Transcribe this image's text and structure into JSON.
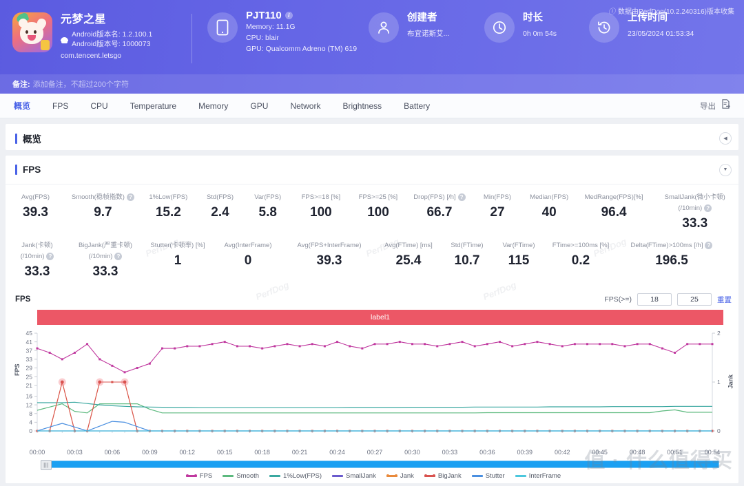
{
  "header": {
    "app": {
      "name": "元梦之星",
      "version_name": "Android版本名: 1.2.100.1",
      "version_code": "Android版本号: 1000073",
      "package": "com.tencent.letsgo"
    },
    "device": {
      "name": "PJT110",
      "memory": "Memory: 11.1G",
      "cpu": "CPU: blair",
      "gpu": "GPU: Qualcomm Adreno (TM) 619"
    },
    "creator": {
      "title": "创建者",
      "value": "布宜诺斯艾..."
    },
    "duration": {
      "title": "时长",
      "value": "0h 0m 54s"
    },
    "upload": {
      "title": "上传时间",
      "value": "23/05/2024 01:53:34"
    },
    "collect_note": "数据由PerfDog(10.2.240316)版本收集",
    "remark_label": "备注:",
    "remark_placeholder": "添加备注，不超过200个字符"
  },
  "tabs": {
    "items": [
      {
        "label": "概览",
        "active": true
      },
      {
        "label": "FPS",
        "active": false
      },
      {
        "label": "CPU",
        "active": false
      },
      {
        "label": "Temperature",
        "active": false
      },
      {
        "label": "Memory",
        "active": false
      },
      {
        "label": "GPU",
        "active": false
      },
      {
        "label": "Network",
        "active": false
      },
      {
        "label": "Brightness",
        "active": false
      },
      {
        "label": "Battery",
        "active": false
      }
    ],
    "export_label": "导出"
  },
  "overview_section": {
    "title": "概览"
  },
  "fps_section": {
    "title": "FPS",
    "metrics_row1": [
      {
        "label": "Avg(FPS)",
        "value": "39.3",
        "help": false
      },
      {
        "label": "Smooth(稳帧指数)",
        "value": "9.7",
        "help": true
      },
      {
        "label": "1%Low(FPS)",
        "value": "15.2",
        "help": false
      },
      {
        "label": "Std(FPS)",
        "value": "2.4",
        "help": false
      },
      {
        "label": "Var(FPS)",
        "value": "5.8",
        "help": false
      },
      {
        "label": "FPS>=18 [%]",
        "value": "100",
        "help": false
      },
      {
        "label": "FPS>=25 [%]",
        "value": "100",
        "help": false
      },
      {
        "label": "Drop(FPS) [/h]",
        "value": "66.7",
        "help": true
      },
      {
        "label": "Min(FPS)",
        "value": "27",
        "help": false
      },
      {
        "label": "Median(FPS)",
        "value": "40",
        "help": false
      },
      {
        "label": "MedRange(FPS)[%]",
        "value": "96.4",
        "help": false
      },
      {
        "label": "SmallJank(微小卡顿)\n(/10min)",
        "value": "33.3",
        "help": true
      }
    ],
    "metrics_row2": [
      {
        "label": "Jank(卡顿)\n(/10min)",
        "value": "33.3",
        "help": true
      },
      {
        "label": "BigJank(严重卡顿)\n(/10min)",
        "value": "33.3",
        "help": true
      },
      {
        "label": "Stutter(卡顿率) [%]",
        "value": "1",
        "help": false
      },
      {
        "label": "Avg(InterFrame)",
        "value": "0",
        "help": false
      },
      {
        "label": "Avg(FPS+InterFrame)",
        "value": "39.3",
        "help": false
      },
      {
        "label": "Avg(FTime) [ms]",
        "value": "25.4",
        "help": false
      },
      {
        "label": "Std(FTime)",
        "value": "10.7",
        "help": false
      },
      {
        "label": "Var(FTime)",
        "value": "115",
        "help": false
      },
      {
        "label": "FTime>=100ms [%]",
        "value": "0.2",
        "help": false
      },
      {
        "label": "Delta(FTime)>100ms [/h]",
        "value": "196.5",
        "help": true
      }
    ],
    "watermark": "PerfDog",
    "chart_controls": {
      "chart_name": "FPS",
      "fps_label": "FPS(>=)",
      "threshold_low": "18",
      "threshold_high": "25",
      "reset_label": "重置"
    },
    "series_label_bar": "label1"
  },
  "colors": {
    "brand": "#4a63e7",
    "header_start": "#5b5be0",
    "header_end": "#7375ea",
    "label_bar": "#ec5766",
    "scrollbar": "#1ba0f2"
  },
  "watermark_text": "值 · 什么值得买",
  "chart_data": {
    "type": "line",
    "title": "FPS",
    "xlabel": "",
    "ylabel": "FPS",
    "y2label": "Jank",
    "ylim": [
      0,
      45
    ],
    "y2lim": [
      0,
      2
    ],
    "yticks": [
      0,
      4,
      8,
      12,
      16,
      21,
      25,
      29,
      33,
      37,
      41,
      45
    ],
    "y2ticks": [
      0,
      1,
      2
    ],
    "grid": false,
    "legend_position": "bottom",
    "xticks": [
      "00:00",
      "00:03",
      "00:06",
      "00:09",
      "00:12",
      "00:15",
      "00:18",
      "00:21",
      "00:24",
      "00:27",
      "00:30",
      "00:33",
      "00:36",
      "00:39",
      "00:42",
      "00:45",
      "00:48",
      "00:51",
      "00:54"
    ],
    "x": [
      0,
      1,
      2,
      3,
      4,
      5,
      6,
      7,
      8,
      9,
      10,
      11,
      12,
      13,
      14,
      15,
      16,
      17,
      18,
      19,
      20,
      21,
      22,
      23,
      24,
      25,
      26,
      27,
      28,
      29,
      30,
      31,
      32,
      33,
      34,
      35,
      36,
      37,
      38,
      39,
      40,
      41,
      42,
      43,
      44,
      45,
      46,
      47,
      48,
      49,
      50,
      51,
      52,
      53,
      54
    ],
    "series": [
      {
        "name": "FPS",
        "color": "#c0399f",
        "axis": "left",
        "markers": true,
        "values": [
          38,
          36,
          33,
          36,
          40,
          33,
          30,
          27,
          29,
          31,
          38,
          38,
          39,
          39,
          40,
          41,
          39,
          39,
          38,
          39,
          40,
          39,
          40,
          39,
          41,
          39,
          38,
          40,
          40,
          41,
          40,
          40,
          39,
          40,
          41,
          39,
          40,
          41,
          39,
          40,
          41,
          40,
          39,
          40,
          40,
          40,
          40,
          39,
          40,
          40,
          38,
          36,
          40,
          40,
          40
        ]
      },
      {
        "name": "Smooth",
        "color": "#5cb97e",
        "axis": "left",
        "markers": false,
        "values": [
          9.5,
          11,
          12.5,
          9,
          8.3,
          12.5,
          12.5,
          12.5,
          12.5,
          10,
          8.3,
          8.3,
          8.3,
          8.3,
          8.3,
          8.3,
          8.3,
          8.3,
          8.3,
          8.3,
          8.3,
          8.3,
          8.3,
          8.3,
          8.3,
          8.3,
          8.3,
          8.3,
          8.3,
          8.3,
          8.3,
          8.3,
          8.3,
          8.3,
          8.3,
          8.3,
          8.4,
          8.4,
          8.4,
          8.4,
          8.4,
          8.4,
          8.4,
          8.4,
          8.4,
          8.4,
          8.4,
          8.4,
          8.4,
          8.4,
          9.2,
          9.7,
          8.6,
          8.6,
          8.6
        ]
      },
      {
        "name": "1%Low(FPS)",
        "color": "#3aa8a0",
        "axis": "left",
        "markers": false,
        "values": [
          13,
          13,
          13,
          13.2,
          12.6,
          12,
          11.6,
          11.3,
          11.1,
          11,
          10.9,
          10.8,
          10.8,
          10.7,
          10.7,
          10.7,
          10.7,
          10.7,
          10.7,
          10.7,
          10.7,
          10.7,
          10.7,
          10.7,
          10.7,
          10.8,
          10.8,
          10.8,
          10.8,
          10.8,
          10.9,
          10.9,
          10.9,
          10.9,
          10.9,
          11,
          11,
          11,
          11,
          11,
          11,
          11.1,
          11.1,
          11.1,
          11.1,
          11.1,
          11.2,
          11.2,
          11.2,
          11.2,
          11.2,
          11.3,
          11.3,
          11.3,
          11.3
        ]
      },
      {
        "name": "SmallJank",
        "color": "#6a5acd",
        "axis": "right",
        "markers": false,
        "values": [
          0,
          0,
          0,
          0,
          0,
          0,
          0,
          0,
          0,
          0,
          0,
          0,
          0,
          0,
          0,
          0,
          0,
          0,
          0,
          0,
          0,
          0,
          0,
          0,
          0,
          0,
          0,
          0,
          0,
          0,
          0,
          0,
          0,
          0,
          0,
          0,
          0,
          0,
          0,
          0,
          0,
          0,
          0,
          0,
          0,
          0,
          0,
          0,
          0,
          0,
          0,
          0,
          0,
          0,
          0
        ]
      },
      {
        "name": "Jank",
        "color": "#e98a3c",
        "axis": "right",
        "markers": true,
        "values": [
          0,
          0,
          1,
          0,
          0,
          1,
          1,
          1,
          0,
          0,
          0,
          0,
          0,
          0,
          0,
          0,
          0,
          0,
          0,
          0,
          0,
          0,
          0,
          0,
          0,
          0,
          0,
          0,
          0,
          0,
          0,
          0,
          0,
          0,
          0,
          0,
          0,
          0,
          0,
          0,
          0,
          0,
          0,
          0,
          0,
          0,
          0,
          0,
          0,
          0,
          0,
          0,
          0,
          0,
          0
        ]
      },
      {
        "name": "BigJank",
        "color": "#d9534f",
        "axis": "right",
        "markers": true,
        "values": [
          0,
          0,
          1,
          0,
          0,
          1,
          1,
          1,
          0,
          0,
          0,
          0,
          0,
          0,
          0,
          0,
          0,
          0,
          0,
          0,
          0,
          0,
          0,
          0,
          0,
          0,
          0,
          0,
          0,
          0,
          0,
          0,
          0,
          0,
          0,
          0,
          0,
          0,
          0,
          0,
          0,
          0,
          0,
          0,
          0,
          0,
          0,
          0,
          0,
          0,
          0,
          0,
          0,
          0,
          0
        ]
      },
      {
        "name": "Stutter",
        "color": "#4a8fe0",
        "axis": "left",
        "markers": false,
        "values": [
          0,
          1.8,
          3.5,
          1.8,
          0,
          2.2,
          4.4,
          4.0,
          2.0,
          0,
          0,
          0,
          0,
          0,
          0,
          0,
          0,
          0,
          0,
          0,
          0,
          0,
          0,
          0,
          0,
          0,
          0,
          0,
          0,
          0,
          0,
          0,
          0,
          0,
          0,
          0,
          0,
          0,
          0,
          0,
          0,
          0,
          0,
          0,
          0,
          0,
          0,
          0,
          0,
          0,
          0,
          0,
          0,
          0,
          0
        ]
      },
      {
        "name": "InterFrame",
        "color": "#4cc7dd",
        "axis": "left",
        "markers": false,
        "values": [
          0,
          0,
          0,
          0,
          0,
          0,
          0,
          0,
          0,
          0,
          0,
          0,
          0,
          0,
          0,
          0,
          0,
          0,
          0,
          0,
          0,
          0,
          0,
          0,
          0,
          0,
          0,
          0,
          0,
          0,
          0,
          0,
          0,
          0,
          0,
          0,
          0,
          0,
          0,
          0,
          0,
          0,
          0,
          0,
          0,
          0,
          0,
          0,
          0,
          0,
          0,
          0,
          0,
          0,
          0
        ]
      }
    ],
    "highlight_points": [
      {
        "x": 2,
        "y": 1,
        "axis": "right"
      },
      {
        "x": 5,
        "y": 1,
        "axis": "right"
      },
      {
        "x": 7,
        "y": 1,
        "axis": "right"
      }
    ]
  }
}
